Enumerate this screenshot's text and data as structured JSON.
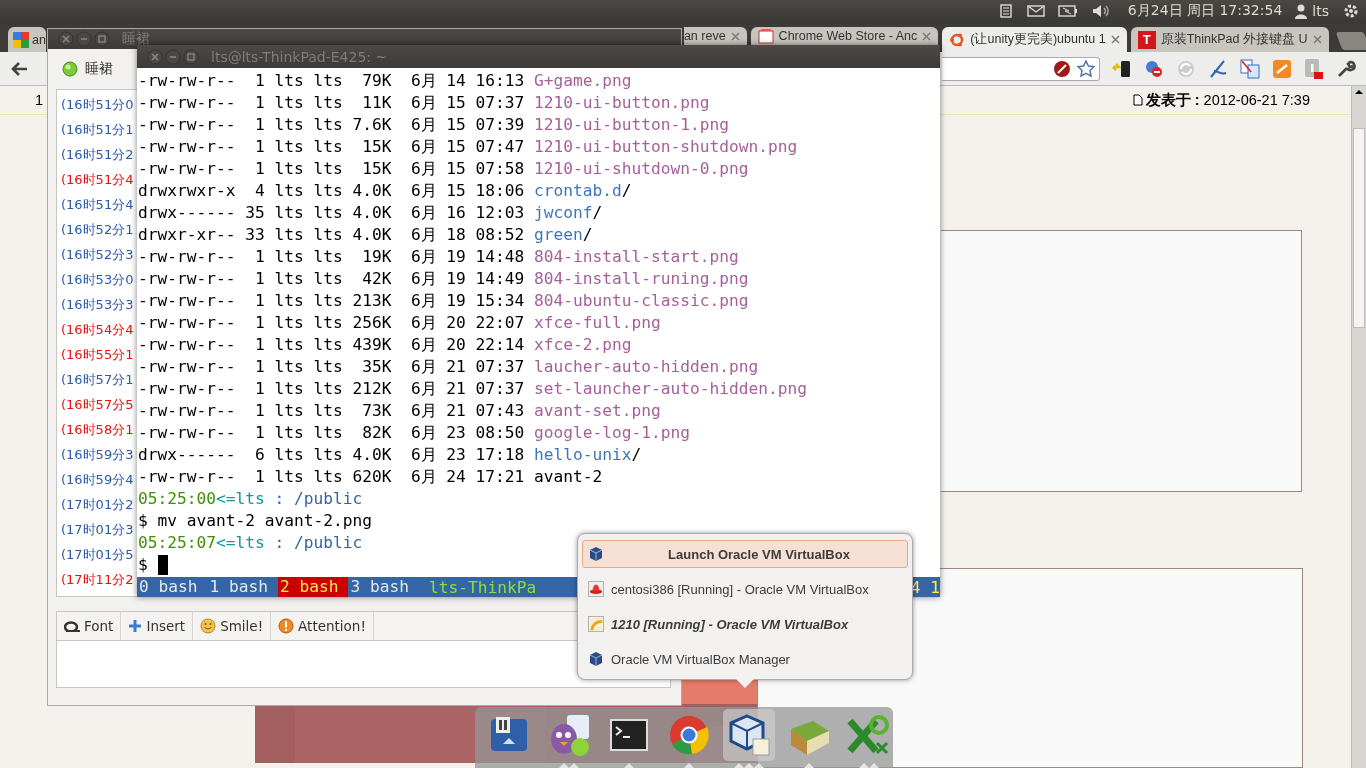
{
  "top_panel": {
    "clock": "6月24日 周日 17:32:54",
    "user": "lts"
  },
  "browser": {
    "tabs": [
      {
        "title": "an",
        "selected": false
      },
      {
        "title": "an reve",
        "selected": false
      },
      {
        "title": "Chrome Web Store - Anc",
        "selected": false
      },
      {
        "title": "(让unity更完美)ubuntu 1",
        "selected": true
      },
      {
        "title": "原装ThinkPad 外接键盘 U",
        "badge": "T",
        "selected": false
      }
    ],
    "post": {
      "floor": "1",
      "posted": "**发表于 :** 2012-06-21 7:39"
    }
  },
  "chat": {
    "title": "睡裙",
    "contact": "睡裙",
    "messages": [
      {
        "time": "(16时51分0",
        "color": "#2a5aa8"
      },
      {
        "time": "(16时51分1",
        "color": "#2a5aa8"
      },
      {
        "time": "(16时51分2",
        "color": "#2a5aa8"
      },
      {
        "time": "(16时51分4",
        "color": "#e8120c"
      },
      {
        "time": "(16时51分4",
        "color": "#2a5aa8"
      },
      {
        "time": "(16时52分1",
        "color": "#2a5aa8"
      },
      {
        "time": "(16时52分3",
        "color": "#2a5aa8"
      },
      {
        "time": "(16时53分0",
        "color": "#2a5aa8"
      },
      {
        "time": "(16时53分3",
        "color": "#2a5aa8"
      },
      {
        "time": "(16时54分4",
        "color": "#e8120c"
      },
      {
        "time": "(16时55分1",
        "color": "#e8120c"
      },
      {
        "time": "(16时57分1",
        "color": "#2a5aa8"
      },
      {
        "time": "(16时57分5",
        "color": "#e8120c"
      },
      {
        "time": "(16时58分1",
        "color": "#e8120c"
      },
      {
        "time": "(16时59分3",
        "color": "#2a5aa8"
      },
      {
        "time": "(16时59分4",
        "color": "#2a5aa8"
      },
      {
        "time": "(17时01分2",
        "color": "#2a5aa8"
      },
      {
        "time": "(17时01分3",
        "color": "#2a5aa8"
      },
      {
        "time": "(17时01分5",
        "color": "#2a5aa8"
      },
      {
        "time": "(17时11分2",
        "color": "#e8120c"
      }
    ],
    "toolbar": [
      "Font",
      "Insert",
      "Smile!",
      "Attention!"
    ]
  },
  "terminal": {
    "title": "lts@lts-ThinkPad-E425: ~",
    "lines": [
      {
        "mode": "-rw-rw-r--",
        "links": "1",
        "user": "lts",
        "group": "lts",
        "size": "79K",
        "month": "6月",
        "day": "14",
        "time": "16:13",
        "name": "G+game.png"
      },
      {
        "mode": "-rw-rw-r--",
        "links": "1",
        "user": "lts",
        "group": "lts",
        "size": "11K",
        "month": "6月",
        "day": "15",
        "time": "07:37",
        "name": "1210-ui-button.png"
      },
      {
        "mode": "-rw-rw-r--",
        "links": "1",
        "user": "lts",
        "group": "lts",
        "size": "7.6K",
        "month": "6月",
        "day": "15",
        "time": "07:39",
        "name": "1210-ui-button-1.png"
      },
      {
        "mode": "-rw-rw-r--",
        "links": "1",
        "user": "lts",
        "group": "lts",
        "size": "15K",
        "month": "6月",
        "day": "15",
        "time": "07:47",
        "name": "1210-ui-button-shutdown.png"
      },
      {
        "mode": "-rw-rw-r--",
        "links": "1",
        "user": "lts",
        "group": "lts",
        "size": "15K",
        "month": "6月",
        "day": "15",
        "time": "07:58",
        "name": "1210-ui-shutdown-0.png"
      },
      {
        "kind": "dir",
        "mode": "drwxrwxr-x",
        "links": "4",
        "user": "lts",
        "group": "lts",
        "size": "4.0K",
        "month": "6月",
        "day": "15",
        "time": "18:06",
        "name": "crontab.d",
        "suffix": "/"
      },
      {
        "kind": "dir",
        "mode": "drwx------",
        "links": "35",
        "user": "lts",
        "group": "lts",
        "size": "4.0K",
        "month": "6月",
        "day": "16",
        "time": "12:03",
        "name": "jwconf",
        "suffix": "/"
      },
      {
        "kind": "dir",
        "mode": "drwxr-xr--",
        "links": "33",
        "user": "lts",
        "group": "lts",
        "size": "4.0K",
        "month": "6月",
        "day": "18",
        "time": "08:52",
        "name": "green",
        "suffix": "/"
      },
      {
        "mode": "-rw-rw-r--",
        "links": "1",
        "user": "lts",
        "group": "lts",
        "size": "19K",
        "month": "6月",
        "day": "19",
        "time": "14:48",
        "name": "804-install-start.png"
      },
      {
        "mode": "-rw-rw-r--",
        "links": "1",
        "user": "lts",
        "group": "lts",
        "size": "42K",
        "month": "6月",
        "day": "19",
        "time": "14:49",
        "name": "804-install-runing.png"
      },
      {
        "mode": "-rw-rw-r--",
        "links": "1",
        "user": "lts",
        "group": "lts",
        "size": "213K",
        "month": "6月",
        "day": "19",
        "time": "15:34",
        "name": "804-ubuntu-classic.png"
      },
      {
        "mode": "-rw-rw-r--",
        "links": "1",
        "user": "lts",
        "group": "lts",
        "size": "256K",
        "month": "6月",
        "day": "20",
        "time": "22:07",
        "name": "xfce-full.png"
      },
      {
        "mode": "-rw-rw-r--",
        "links": "1",
        "user": "lts",
        "group": "lts",
        "size": "439K",
        "month": "6月",
        "day": "20",
        "time": "22:14",
        "name": "xfce-2.png"
      },
      {
        "mode": "-rw-rw-r--",
        "links": "1",
        "user": "lts",
        "group": "lts",
        "size": "35K",
        "month": "6月",
        "day": "21",
        "time": "07:37",
        "name": "laucher-auto-hidden.png"
      },
      {
        "mode": "-rw-rw-r--",
        "links": "1",
        "user": "lts",
        "group": "lts",
        "size": "212K",
        "month": "6月",
        "day": "21",
        "time": "07:37",
        "name": "set-launcher-auto-hidden.png"
      },
      {
        "mode": "-rw-rw-r--",
        "links": "1",
        "user": "lts",
        "group": "lts",
        "size": "73K",
        "month": "6月",
        "day": "21",
        "time": "07:43",
        "name": "avant-set.png"
      },
      {
        "mode": "-rw-rw-r--",
        "links": "1",
        "user": "lts",
        "group": "lts",
        "size": "82K",
        "month": "6月",
        "day": "23",
        "time": "08:50",
        "name": "google-log-1.png"
      },
      {
        "kind": "dir",
        "mode": "drwx------",
        "links": "6",
        "user": "lts",
        "group": "lts",
        "size": "4.0K",
        "month": "6月",
        "day": "23",
        "time": "17:18",
        "name": "hello-unix",
        "suffix": "/"
      },
      {
        "kind": "file",
        "mode": "-rw-rw-r--",
        "links": "1",
        "user": "lts",
        "group": "lts",
        "size": "620K",
        "month": "6月",
        "day": "24",
        "time": "17:21",
        "name": "avant-2"
      },
      {
        "kind": "prompt",
        "time": "05:25:00",
        "who": "<=lts",
        "path": ": /public"
      },
      {
        "kind": "command",
        "sign": "$",
        "text": "mv avant-2 avant-2.png",
        "cursor": false
      },
      {
        "kind": "prompt",
        "time": "05:25:07",
        "who": "<=lts",
        "path": ": /public"
      },
      {
        "kind": "command",
        "sign": "$",
        "cursor": true
      }
    ],
    "status": {
      "windows": [
        {
          "label": "0 bash",
          "selected": false
        },
        {
          "label": "1 bash",
          "selected": false
        },
        {
          "label": "2 bash",
          "selected": true
        },
        {
          "label": "3 bash",
          "selected": false
        }
      ],
      "host": "lts-ThinkPa",
      "right": "4 1"
    }
  },
  "popup": {
    "items": [
      {
        "kind": "launch",
        "label": "Launch Oracle VM VirtualBox",
        "selected": true,
        "active": false
      },
      {
        "kind": "window",
        "label": "centosi386 [Running] - Oracle VM VirtualBox",
        "selected": false,
        "active": false
      },
      {
        "kind": "window",
        "label": "1210 [Running] - Oracle VM VirtualBox",
        "selected": false,
        "active": true
      },
      {
        "kind": "window",
        "label": "Oracle VM VirtualBox Manager",
        "selected": false,
        "active": false
      }
    ]
  },
  "dock": [
    {
      "selected": false
    },
    {
      "windows": [
        {
          "selected": false
        },
        {
          "selected": false
        }
      ],
      "selected": false
    },
    {
      "windows": [
        {
          "selected": false
        }
      ],
      "selected": false
    },
    {
      "windows": [
        {
          "selected": false
        }
      ],
      "selected": false
    },
    {
      "windows": [
        {
          "selected": false
        },
        {
          "selected": false
        },
        {
          "selected": false
        }
      ],
      "selected": true
    },
    {
      "windows": [
        {
          "selected": false
        }
      ],
      "selected": false
    },
    {
      "windows": [
        {
          "selected": false
        },
        {
          "selected": false
        }
      ],
      "selected": false
    }
  ]
}
